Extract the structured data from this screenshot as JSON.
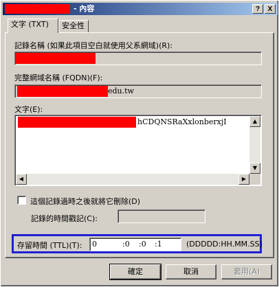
{
  "title": {
    "suffix": "- 內容"
  },
  "titlebar_buttons": {
    "help": "?",
    "close": "X"
  },
  "tabs": [
    {
      "label": "文字 (TXT)"
    },
    {
      "label": "安全性"
    }
  ],
  "record_name": {
    "label": "記錄名稱 (如果此項目空白就使用父系網域)(R):"
  },
  "fqdn": {
    "label": "完整網域名稱 (FQDN)(F):",
    "value_visible": "edu.tw"
  },
  "text": {
    "label": "文字(E):",
    "value_visible": "hCDQNSRaXxlonberxjI"
  },
  "delete_on_expire": {
    "label": "這個記錄過時之後就將它刪除(D)",
    "checked": false
  },
  "timestamp": {
    "label": "記錄的時間戳記(C):"
  },
  "ttl": {
    "label": "存留時間 (TTL)(T):",
    "days": "0",
    "hours": ":0",
    "minutes": ":0",
    "seconds": ":1",
    "format": "(DDDDD:HH.MM.SS)"
  },
  "buttons": {
    "ok": "確定",
    "cancel": "取消",
    "apply": "套用(A)"
  },
  "colors": {
    "redaction": "#ff0000",
    "highlight_frame": "#1f1fd6",
    "title_bar": "#0a246a"
  }
}
